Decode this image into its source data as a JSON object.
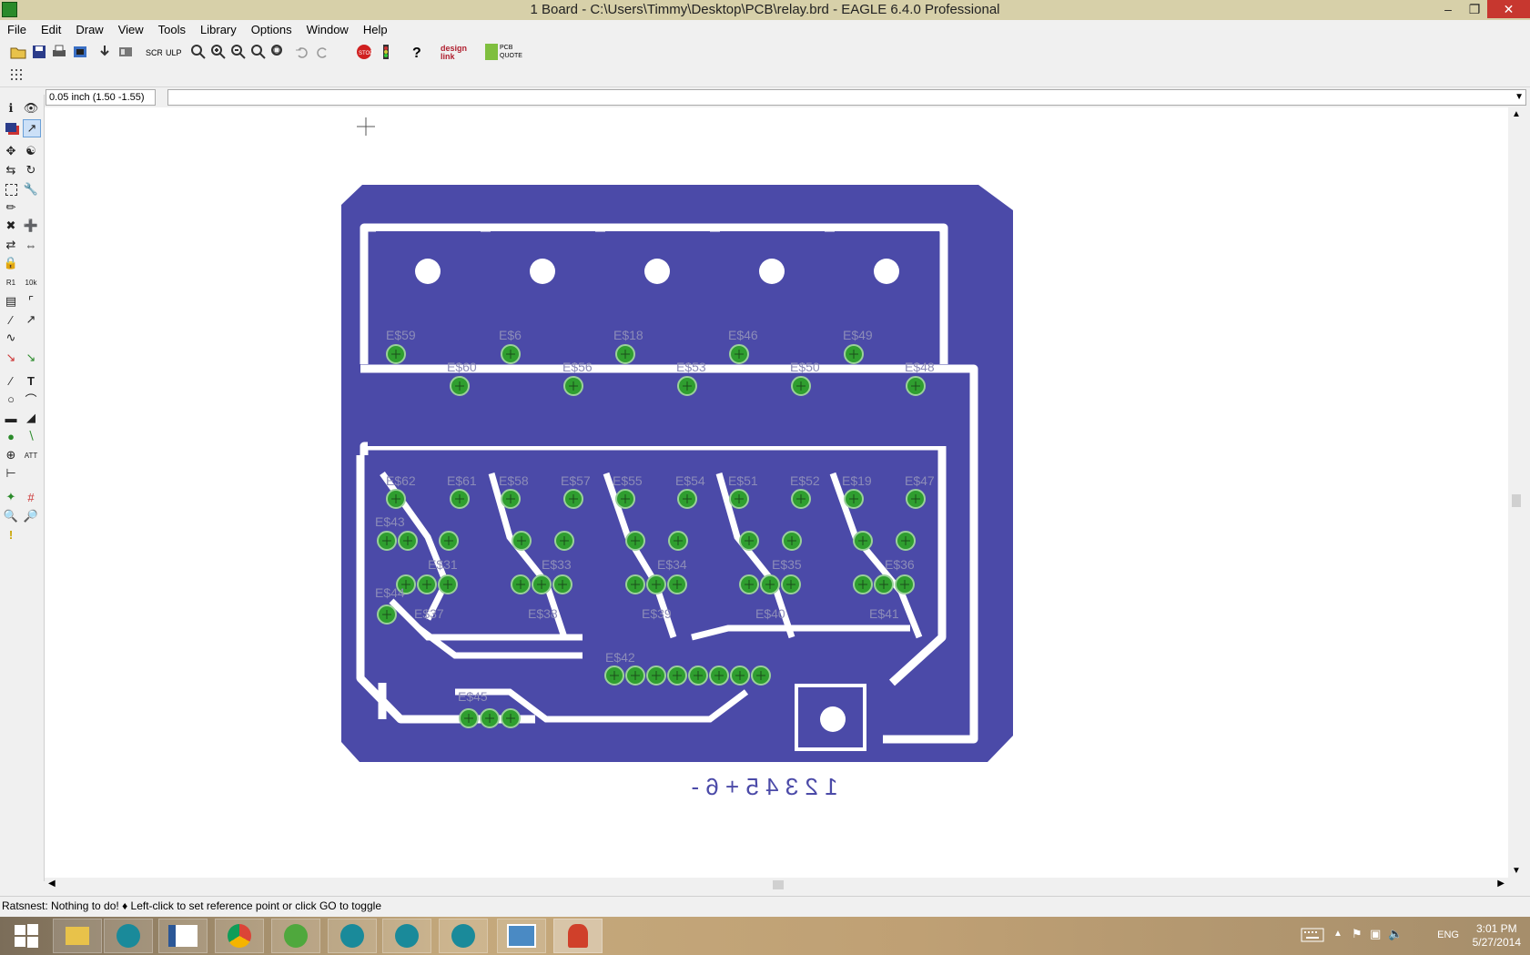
{
  "window": {
    "title": "1 Board - C:\\Users\\Timmy\\Desktop\\PCB\\relay.brd - EAGLE 6.4.0 Professional",
    "minimize": "–",
    "restore": "❐",
    "close": "✕"
  },
  "menu": [
    "File",
    "Edit",
    "Draw",
    "View",
    "Tools",
    "Library",
    "Options",
    "Window",
    "Help"
  ],
  "toolbar": {
    "icons": [
      "open-icon",
      "save-icon",
      "print-icon",
      "cam-icon",
      "export-icon",
      "ulp-icon",
      "script-icon",
      "ulp-run-icon",
      "zoom-fit-icon",
      "zoom-in-icon",
      "zoom-out-icon",
      "zoom-redraw-icon",
      "zoom-select-icon",
      "undo-icon",
      "redo-icon",
      "stop-icon",
      "go-icon",
      "help-icon",
      "design-link-icon",
      "pcb-quote-icon"
    ],
    "design_link": "design link",
    "pcb_quote": "PCB QUOTE"
  },
  "coord": "0.05 inch (1.50 -1.55)",
  "command_value": "",
  "board": {
    "silk_text": "1 2 3 4 5 + 6 -",
    "relay_labels": [
      "E$59",
      "E$6",
      "E$18",
      "E$46",
      "E$49"
    ],
    "row2_labels": [
      "E$60",
      "E$56",
      "E$53",
      "E$50",
      "E$48"
    ],
    "row3_labels": [
      "E$62",
      "E$61",
      "E$58",
      "E$57",
      "E$55",
      "E$54",
      "E$51",
      "E$52",
      "E$19",
      "E$47"
    ],
    "bottom_labels": [
      "E$37",
      "E$38",
      "E$39",
      "E$40",
      "E$41"
    ],
    "mid_labels": [
      "E$31",
      "E$33",
      "E$34",
      "E$35",
      "E$36"
    ],
    "misc_labels": [
      "E$43",
      "E$44",
      "E$42",
      "E$45"
    ]
  },
  "status": "Ratsnest: Nothing to do!  ♦ Left-click to set reference point or click GO to toggle",
  "taskbar": {
    "apps": [
      "start-button",
      "file-explorer-icon",
      "arduino-icon",
      "notes-icon",
      "chrome-icon",
      "utorrent-icon",
      "arduino-icon-2",
      "arduino-icon-3",
      "arduino-icon-4",
      "photos-icon",
      "eagle-icon"
    ],
    "language": "ENG",
    "time": "3:01 PM",
    "date": "5/27/2014"
  },
  "colors": {
    "copper": "#4b4aa8",
    "pad": "#2f9e2f",
    "label": "#8c8cb8"
  }
}
